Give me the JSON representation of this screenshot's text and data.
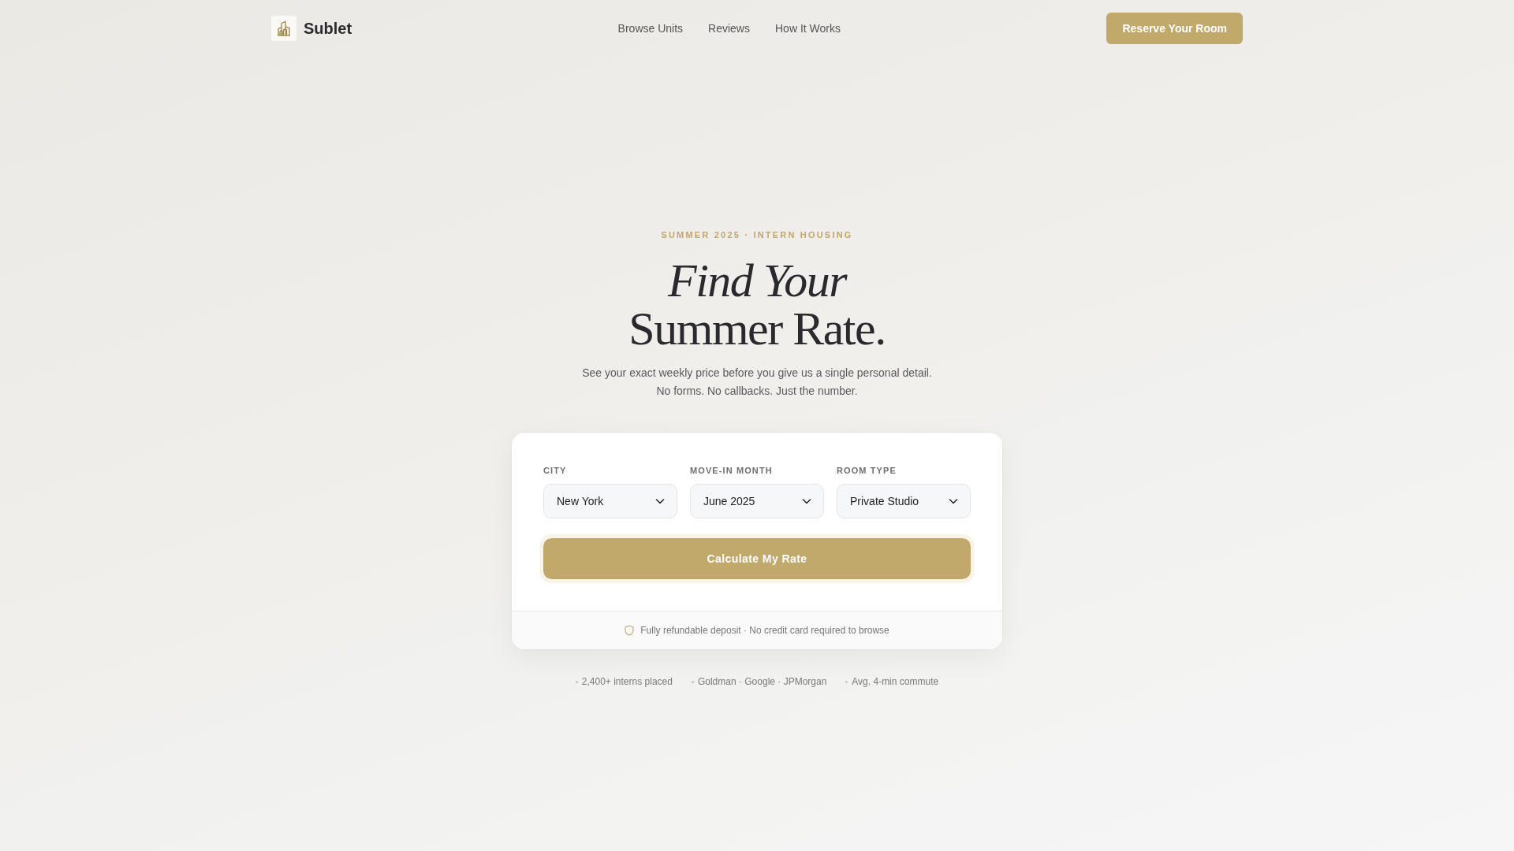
{
  "header": {
    "brand": "Sublet",
    "nav": [
      "Browse Units",
      "Reviews",
      "How It Works"
    ],
    "cta": "Reserve Your Room"
  },
  "hero": {
    "eyebrow": "SUMMER 2025 · INTERN HOUSING",
    "title_lines": [
      "*Find Your*",
      "Summer Rate."
    ],
    "subtitle_lines": [
      "See your exact weekly price before you give us a single personal detail.",
      "No forms. No callbacks. Just the number."
    ]
  },
  "rate_form": {
    "fields": [
      {
        "label": "CITY",
        "value": "New York"
      },
      {
        "label": "MOVE-IN MONTH",
        "value": "June 2025"
      },
      {
        "label": "ROOM TYPE",
        "value": "Private Studio"
      }
    ],
    "submit": "Calculate My Rate",
    "note": "Fully refundable deposit · No credit card required to browse"
  },
  "stats": [
    "2,400+ interns placed",
    "Goldman · Google · JPMorgan",
    "Avg. 4-min commute"
  ]
}
